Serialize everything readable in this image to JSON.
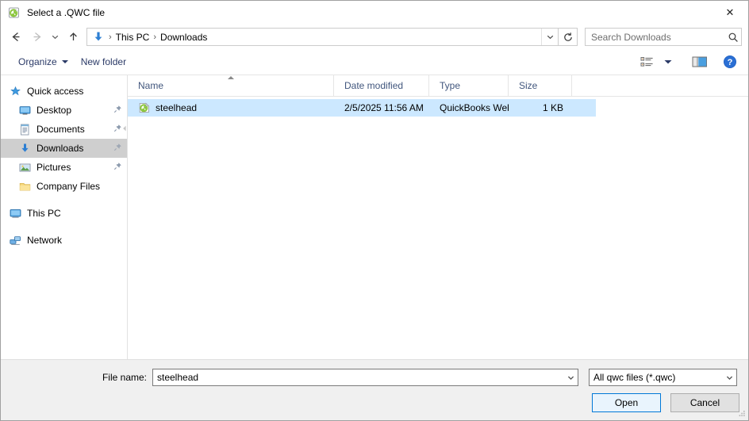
{
  "window": {
    "title": "Select a .QWC file",
    "title_icon": "qwc-file-icon",
    "close_label": "✕"
  },
  "navigation": {
    "back_icon": "back-arrow-icon",
    "forward_icon": "forward-arrow-icon",
    "recent_icon": "recent-locations-chevron-icon",
    "up_icon": "up-arrow-icon",
    "refresh_icon": "refresh-icon",
    "breadcrumb_icon": "downloads-folder-icon",
    "breadcrumbs": [
      "This PC",
      "Downloads"
    ],
    "separator": "›"
  },
  "search": {
    "placeholder": "Search Downloads",
    "value": "",
    "icon": "search-icon"
  },
  "toolbar": {
    "organize_label": "Organize",
    "new_folder_label": "New folder",
    "view_options_icon": "view-options-icon",
    "view_caret_icon": "chevron-down-icon",
    "preview_pane_icon": "preview-pane-icon",
    "help_icon": "help-icon"
  },
  "sidebar": {
    "items": [
      {
        "label": "Quick access",
        "icon": "star-icon",
        "level": "root",
        "pinned": false,
        "selected": false
      },
      {
        "label": "Desktop",
        "icon": "desktop-icon",
        "level": "child",
        "pinned": true,
        "selected": false
      },
      {
        "label": "Documents",
        "icon": "documents-icon",
        "level": "child",
        "pinned": true,
        "selected": false
      },
      {
        "label": "Downloads",
        "icon": "downloads-icon",
        "level": "child",
        "pinned": true,
        "selected": true
      },
      {
        "label": "Pictures",
        "icon": "pictures-icon",
        "level": "child",
        "pinned": true,
        "selected": false
      },
      {
        "label": "Company Files",
        "icon": "folder-icon",
        "level": "child",
        "pinned": false,
        "selected": false
      },
      {
        "label": "This PC",
        "icon": "this-pc-icon",
        "level": "root",
        "pinned": false,
        "selected": false
      },
      {
        "label": "Network",
        "icon": "network-icon",
        "level": "root",
        "pinned": false,
        "selected": false
      }
    ]
  },
  "filelist": {
    "columns": [
      {
        "label": "Name",
        "sorted": true
      },
      {
        "label": "Date modified",
        "sorted": false
      },
      {
        "label": "Type",
        "sorted": false
      },
      {
        "label": "Size",
        "sorted": false
      }
    ],
    "sort_direction": "ascending",
    "rows": [
      {
        "icon": "qwc-file-icon",
        "name": "steelhead",
        "date_modified": "2/5/2025 11:56 AM",
        "type": "QuickBooks Web ...",
        "size": "1 KB",
        "selected": true
      }
    ]
  },
  "footer": {
    "file_name_label": "File name:",
    "file_name_value": "steelhead",
    "file_name_dropdown_icon": "chevron-down-icon",
    "file_type_value": "All qwc files (*.qwc)",
    "file_type_dropdown_icon": "chevron-down-icon",
    "open_label": "Open",
    "cancel_label": "Cancel",
    "resize_grip_icon": "resize-grip-icon"
  },
  "colors": {
    "selection_blue": "#cce8ff",
    "sidebar_selected_gray": "#cfcfcf",
    "accent_blue": "#0078d7",
    "column_header_text": "#41567d",
    "toolbar_text": "#2b3a67",
    "panel_gray": "#f0f0f0"
  }
}
